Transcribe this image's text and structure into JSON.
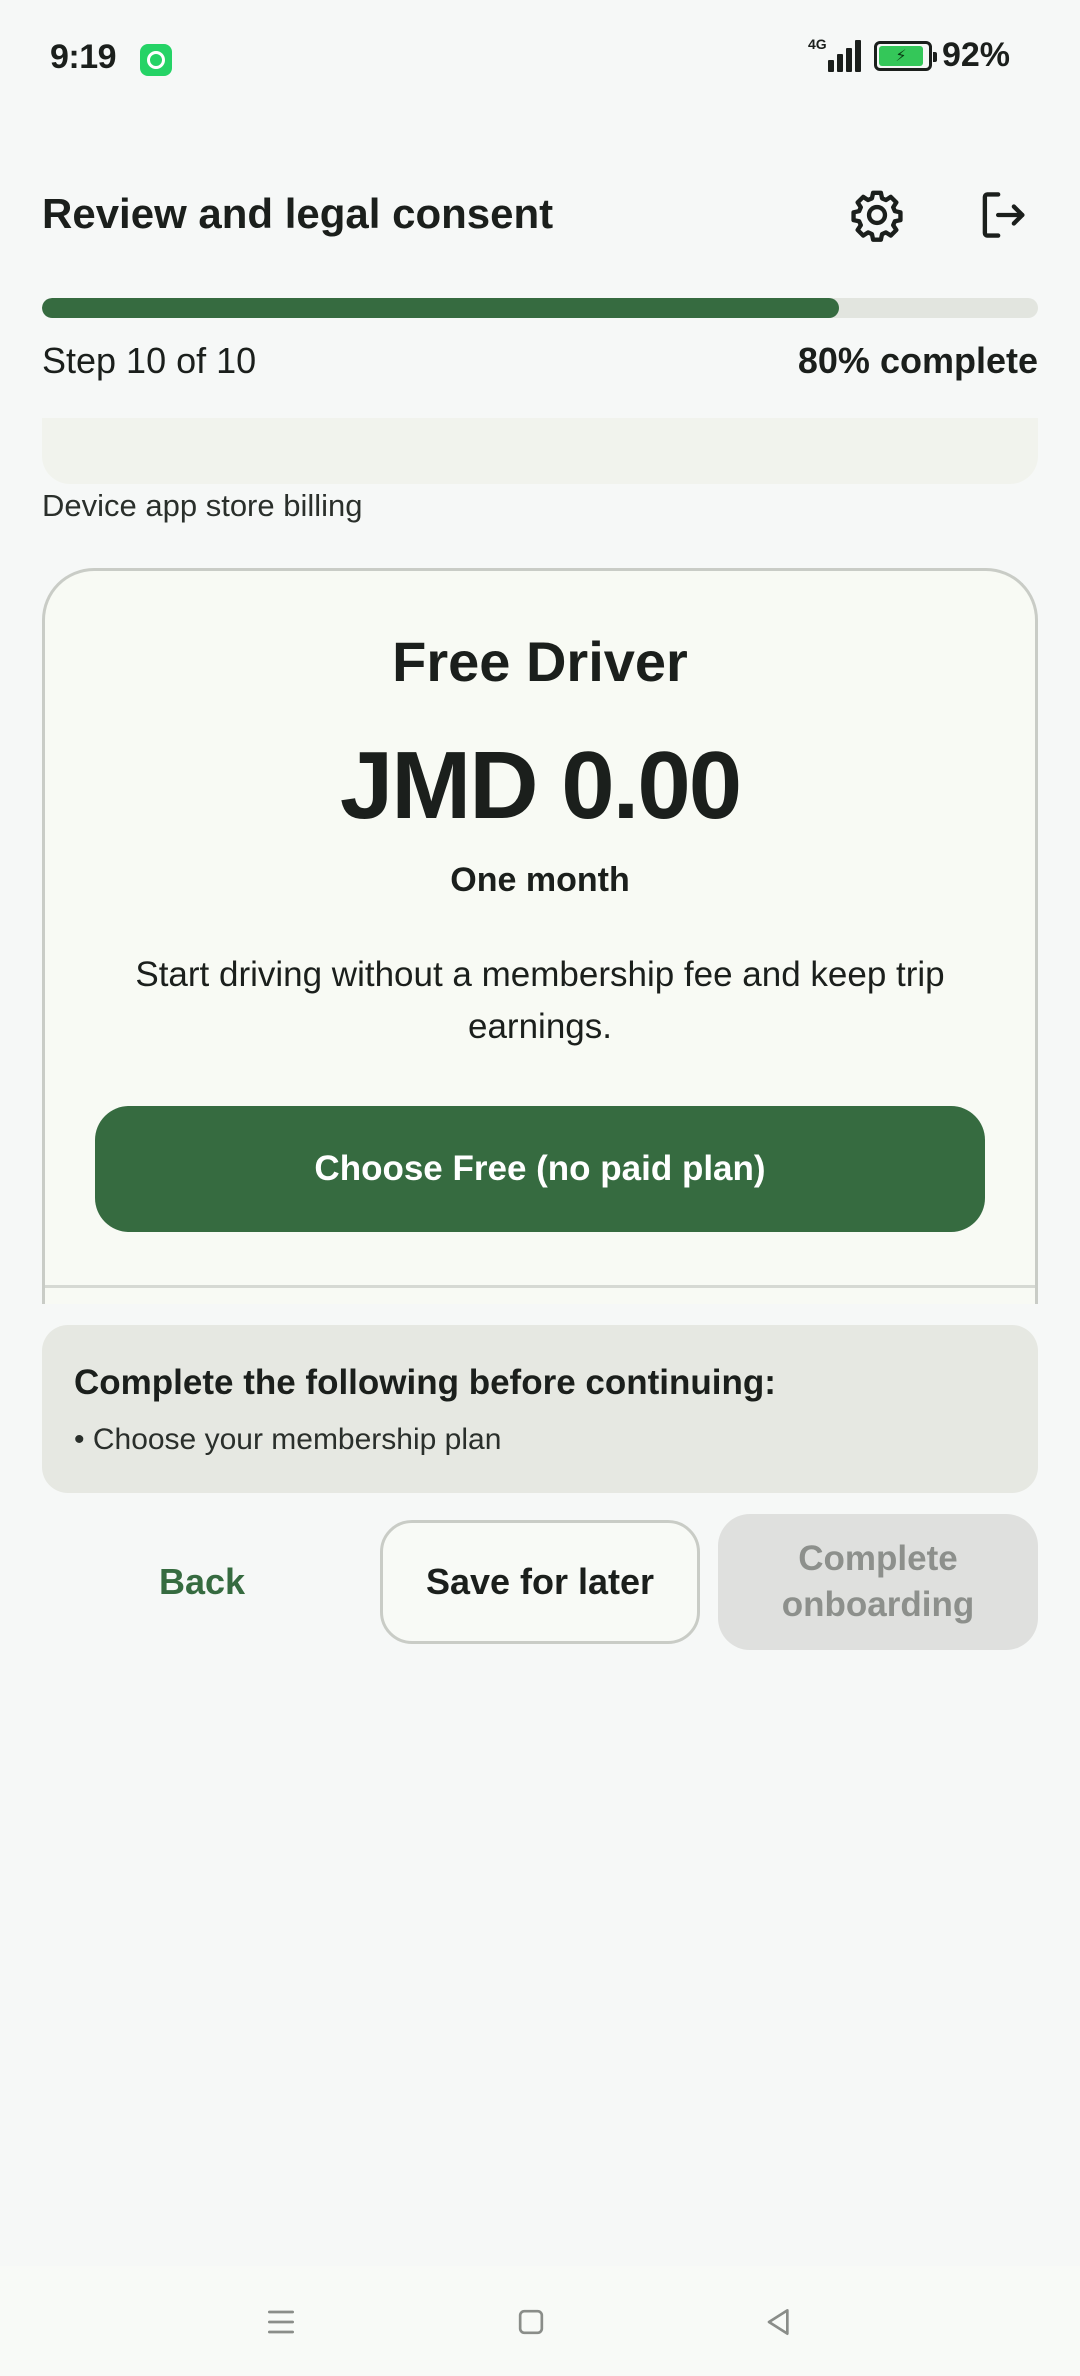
{
  "status_bar": {
    "time": "9:19",
    "network": "4G",
    "battery_percent": "92%",
    "battery_level": 0.92,
    "icons": [
      "whatsapp-icon",
      "signal-icon",
      "battery-charging-icon"
    ]
  },
  "header": {
    "title": "Review and legal consent",
    "settings_icon": "gear-icon",
    "logout_icon": "logout-icon"
  },
  "progress": {
    "step_label": "Step 10 of 10",
    "complete_label": "80% complete",
    "fraction": 0.8
  },
  "billing_note": "Device app store billing",
  "plan": {
    "name": "Free Driver",
    "price": "JMD 0.00",
    "period": "One month",
    "description": "Start driving without a membership fee and keep trip earnings.",
    "choose_label": "Choose Free (no paid plan)"
  },
  "requirements": {
    "title": "Complete the following before continuing:",
    "items": [
      "• Choose your membership plan"
    ]
  },
  "actions": {
    "back_label": "Back",
    "save_label": "Save for later",
    "complete_label": "Complete onboarding"
  },
  "colors": {
    "primary": "#366b40",
    "background": "#f6f8f7",
    "disabled": "#dfe0de"
  },
  "nav_bar": {
    "icons": [
      "menu-icon",
      "home-icon",
      "back-icon"
    ]
  }
}
